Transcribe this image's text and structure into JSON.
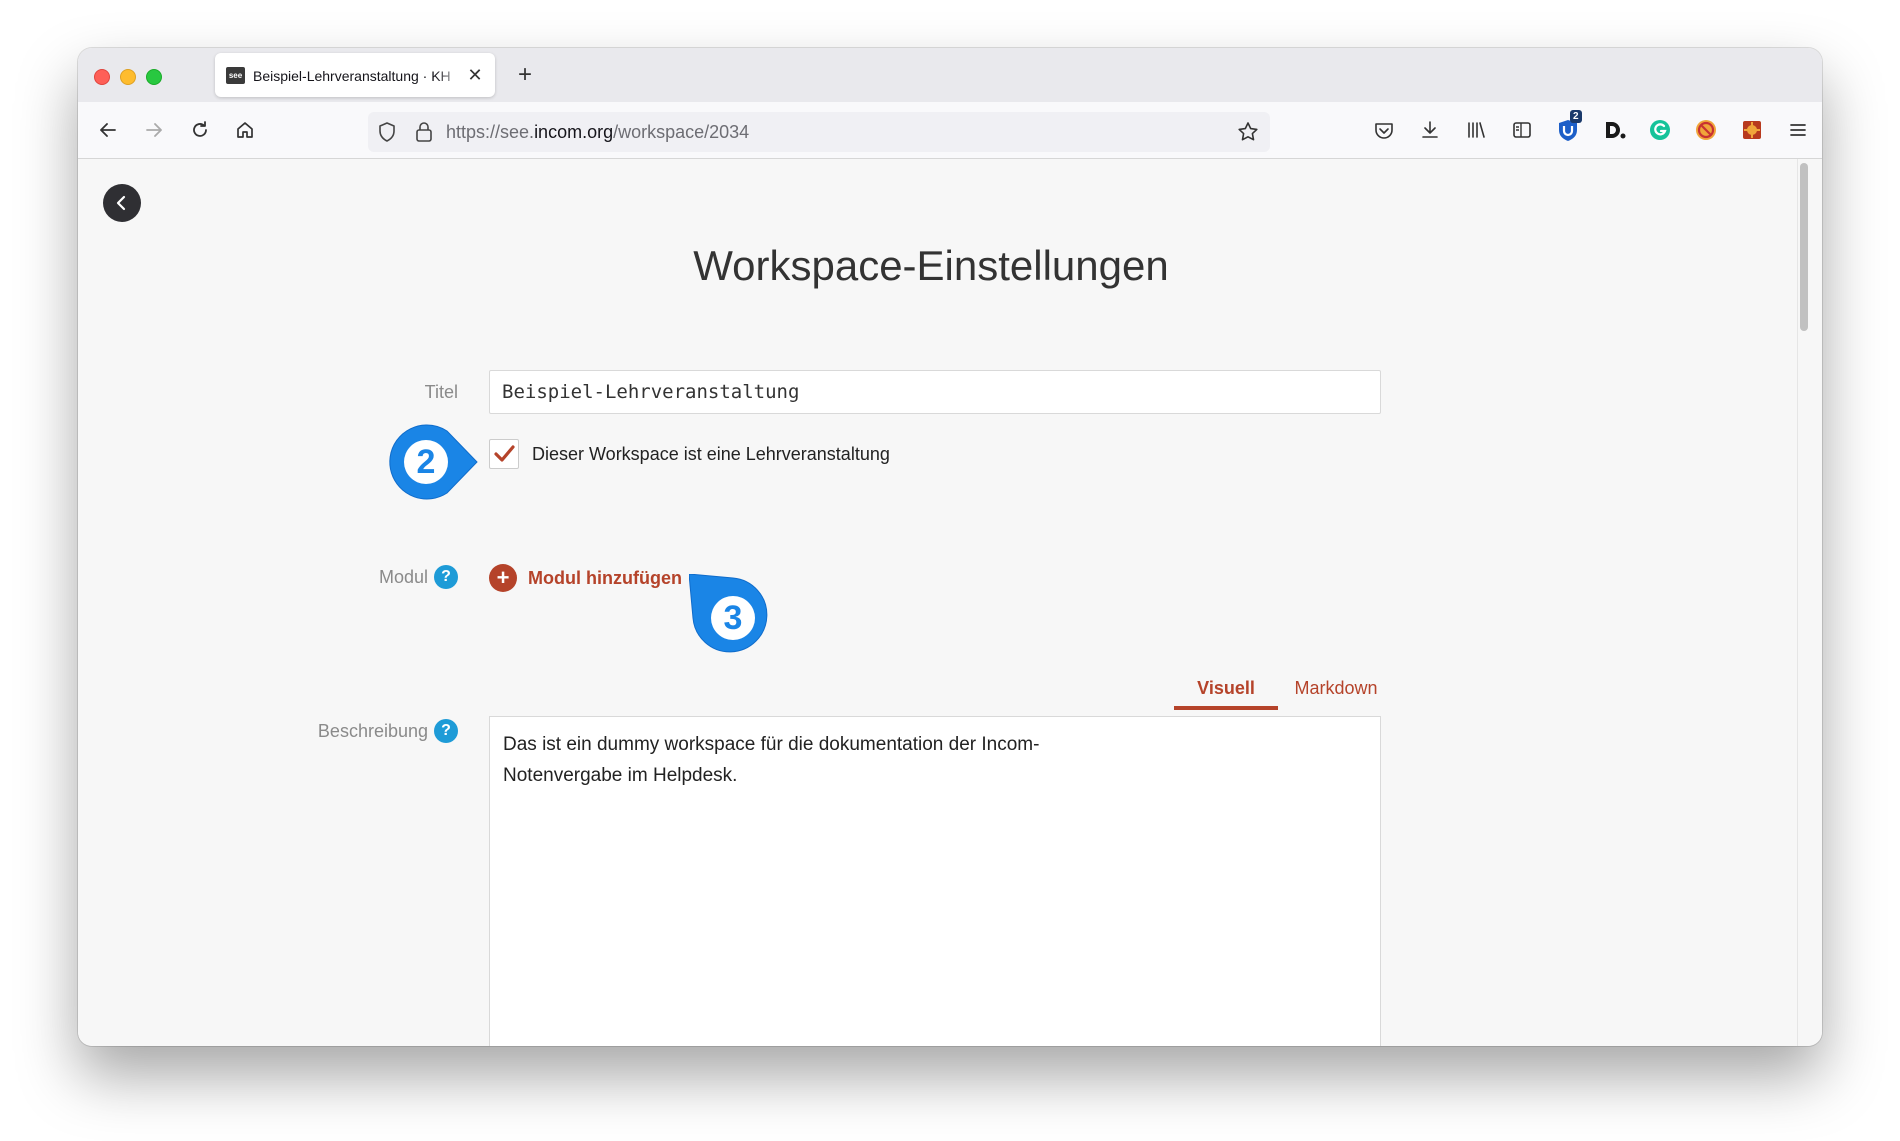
{
  "browser": {
    "tab_title": "Beispiel-Lehrveranstaltung · KH",
    "tab_favicon": "see",
    "new_tab": "+",
    "url_prefix": "https://see.",
    "url_domain": "incom.org",
    "url_path": "/workspace/2034",
    "extension_badge": "2"
  },
  "page": {
    "title": "Workspace-Einstellungen",
    "titel_label": "Titel",
    "titel_value": "Beispiel-Lehrveranstaltung",
    "checkbox_label": "Dieser Workspace ist eine Lehrveranstaltung",
    "checkbox_checked": true,
    "modul_label": "Modul",
    "add_module_label": "Modul hinzufügen",
    "beschreibung_label": "Beschreibung",
    "help_glyph": "?",
    "editor_tabs": [
      "Visuell",
      "Markdown"
    ],
    "editor_active_tab": "Visuell",
    "description": "Das ist ein dummy workspace für die dokumentation der Incom-Notenvergabe im Helpdesk."
  },
  "callouts": [
    "2",
    "3"
  ],
  "colors": {
    "accent": "#b5432a",
    "help": "#1e9bd7",
    "callout": "#1a85e6"
  }
}
